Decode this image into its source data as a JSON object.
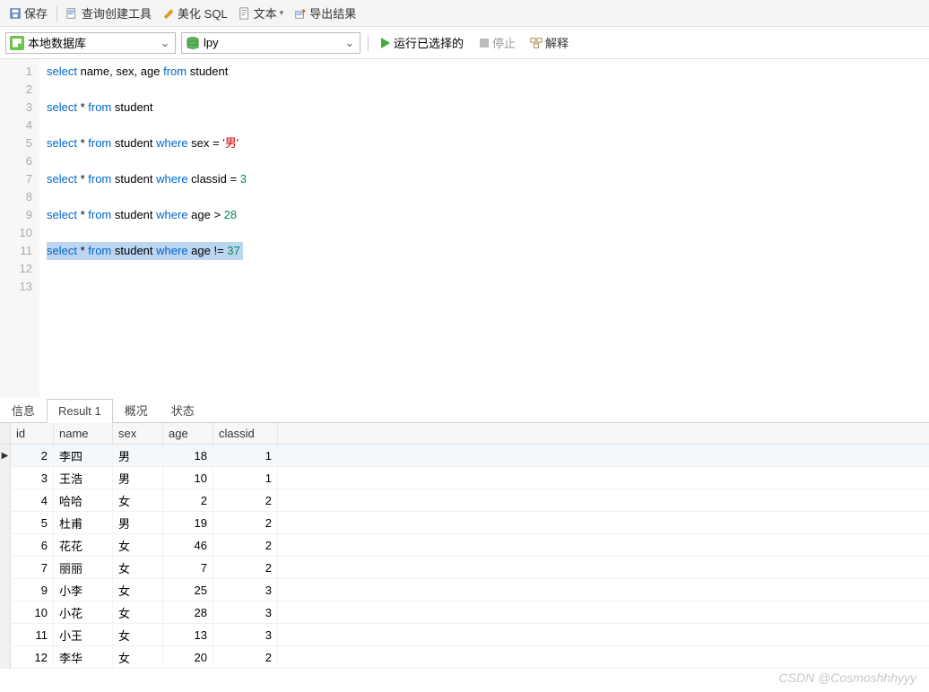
{
  "toolbar": {
    "save": "保存",
    "query_builder": "查询创建工具",
    "beautify": "美化 SQL",
    "text": "文本",
    "export": "导出结果"
  },
  "toolbar2": {
    "connection": "本地数据库",
    "database": "lpy",
    "run": "运行已选择的",
    "stop": "停止",
    "explain": "解释"
  },
  "editor": {
    "lines": [
      "1",
      "2",
      "3",
      "4",
      "5",
      "6",
      "7",
      "8",
      "9",
      "10",
      "11",
      "12",
      "13"
    ],
    "code": [
      {
        "n": 1,
        "tokens": [
          [
            "kw",
            "select"
          ],
          [
            "",
            " name, sex, age "
          ],
          [
            "kw",
            "from"
          ],
          [
            "",
            " student"
          ]
        ]
      },
      {
        "n": 2,
        "tokens": []
      },
      {
        "n": 3,
        "tokens": [
          [
            "kw",
            "select"
          ],
          [
            "",
            " * "
          ],
          [
            "kw",
            "from"
          ],
          [
            "",
            " student"
          ]
        ]
      },
      {
        "n": 4,
        "tokens": []
      },
      {
        "n": 5,
        "tokens": [
          [
            "kw",
            "select"
          ],
          [
            "",
            " * "
          ],
          [
            "kw",
            "from"
          ],
          [
            "",
            " student "
          ],
          [
            "kw",
            "where"
          ],
          [
            "",
            " sex = "
          ],
          [
            "str",
            "'男'"
          ]
        ]
      },
      {
        "n": 6,
        "tokens": []
      },
      {
        "n": 7,
        "tokens": [
          [
            "kw",
            "select"
          ],
          [
            "",
            " * "
          ],
          [
            "kw",
            "from"
          ],
          [
            "",
            " student "
          ],
          [
            "kw",
            "where"
          ],
          [
            "",
            " classid = "
          ],
          [
            "num",
            "3"
          ]
        ]
      },
      {
        "n": 8,
        "tokens": []
      },
      {
        "n": 9,
        "tokens": [
          [
            "kw",
            "select"
          ],
          [
            "",
            " * "
          ],
          [
            "kw",
            "from"
          ],
          [
            "",
            " student "
          ],
          [
            "kw",
            "where"
          ],
          [
            "",
            " age > "
          ],
          [
            "num",
            "28"
          ]
        ]
      },
      {
        "n": 10,
        "tokens": []
      },
      {
        "n": 11,
        "highlight": true,
        "tokens": [
          [
            "kw",
            "select"
          ],
          [
            "",
            " * "
          ],
          [
            "kw",
            "from"
          ],
          [
            "",
            " student "
          ],
          [
            "kw",
            "where"
          ],
          [
            "",
            " age != "
          ],
          [
            "num",
            "37"
          ],
          [
            "",
            " "
          ]
        ]
      },
      {
        "n": 12,
        "tokens": []
      },
      {
        "n": 13,
        "tokens": []
      }
    ]
  },
  "result_tabs": {
    "info": "信息",
    "result1": "Result 1",
    "profile": "概况",
    "status": "状态"
  },
  "grid": {
    "headers": {
      "id": "id",
      "name": "name",
      "sex": "sex",
      "age": "age",
      "classid": "classid"
    },
    "rows": [
      {
        "id": "2",
        "name": "李四",
        "sex": "男",
        "age": "18",
        "classid": "1",
        "active": true
      },
      {
        "id": "3",
        "name": "王浩",
        "sex": "男",
        "age": "10",
        "classid": "1"
      },
      {
        "id": "4",
        "name": "哈哈",
        "sex": "女",
        "age": "2",
        "classid": "2"
      },
      {
        "id": "5",
        "name": "杜甫",
        "sex": "男",
        "age": "19",
        "classid": "2"
      },
      {
        "id": "6",
        "name": "花花",
        "sex": "女",
        "age": "46",
        "classid": "2"
      },
      {
        "id": "7",
        "name": "丽丽",
        "sex": "女",
        "age": "7",
        "classid": "2"
      },
      {
        "id": "9",
        "name": "小李",
        "sex": "女",
        "age": "25",
        "classid": "3"
      },
      {
        "id": "10",
        "name": "小花",
        "sex": "女",
        "age": "28",
        "classid": "3"
      },
      {
        "id": "11",
        "name": "小王",
        "sex": "女",
        "age": "13",
        "classid": "3"
      },
      {
        "id": "12",
        "name": "李华",
        "sex": "女",
        "age": "20",
        "classid": "2"
      }
    ]
  },
  "watermark": "CSDN @Cosmoshhhyyy"
}
